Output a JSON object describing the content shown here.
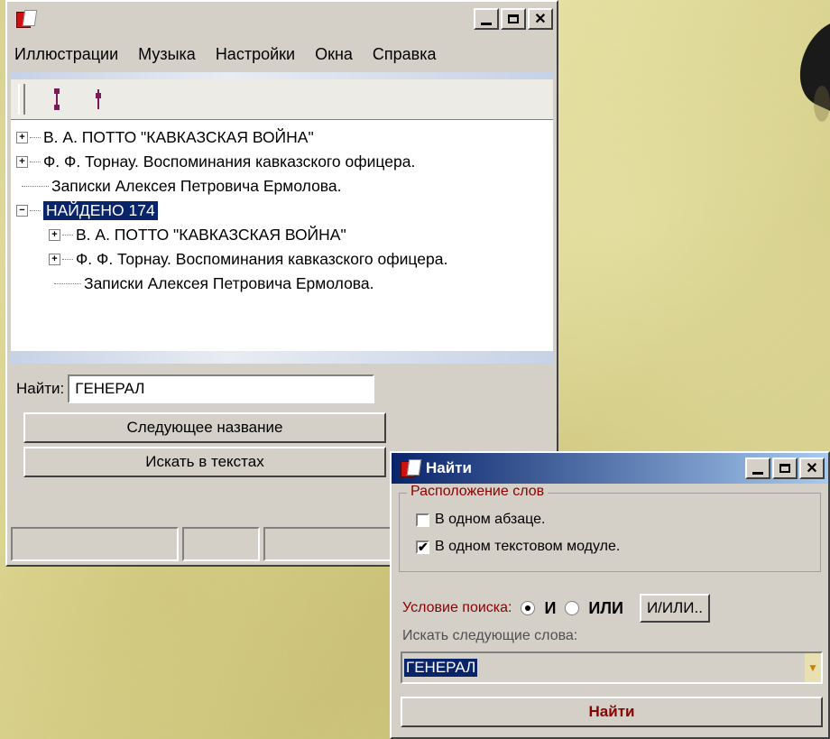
{
  "main_window": {
    "menu": [
      "Иллюстрации",
      "Музыка",
      "Настройки",
      "Окна",
      "Справка"
    ],
    "tree": [
      {
        "text": "В. А. ПОТТО \"КАВКАЗСКАЯ ВОЙНА\"",
        "expander": "+",
        "level": 0
      },
      {
        "text": "Ф. Ф. Торнау. Воспоминания кавказского офицера.",
        "expander": "+",
        "level": 0
      },
      {
        "text": "Записки Алексея Петровича Ермолова.",
        "expander": "",
        "level": 0
      },
      {
        "text": "НАЙДЕНО 174",
        "expander": "−",
        "level": 0,
        "selected": true
      },
      {
        "text": "В. А. ПОТТО \"КАВКАЗСКАЯ ВОЙНА\"",
        "expander": "+",
        "level": 1
      },
      {
        "text": "Ф. Ф. Торнау. Воспоминания кавказского офицера.",
        "expander": "+",
        "level": 1
      },
      {
        "text": "Записки Алексея Петровича Ермолова.",
        "expander": "",
        "level": 1
      }
    ],
    "find_label": "Найти:",
    "find_value": "ГЕНЕРАЛ",
    "next_title_button": "Следующее название",
    "search_texts_button": "Искать в текстах"
  },
  "find_window": {
    "title": "Найти",
    "group_title": "Расположение слов",
    "option_paragraph": "В одном абзаце.",
    "option_paragraph_checked": false,
    "option_module": "В одном текстовом модуле.",
    "option_module_checked": true,
    "condition_label": "Условие поиска:",
    "condition_and": "И",
    "condition_or": "ИЛИ",
    "condition_selected": "И",
    "and_or_button": "И/ИЛИ..",
    "words_label": "Искать следующие слова:",
    "words_value": "ГЕНЕРАЛ",
    "find_button": "Найти"
  },
  "colors": {
    "window_face": "#d4d0c8",
    "selection": "#0a246a",
    "label_red": "#8b0000"
  }
}
